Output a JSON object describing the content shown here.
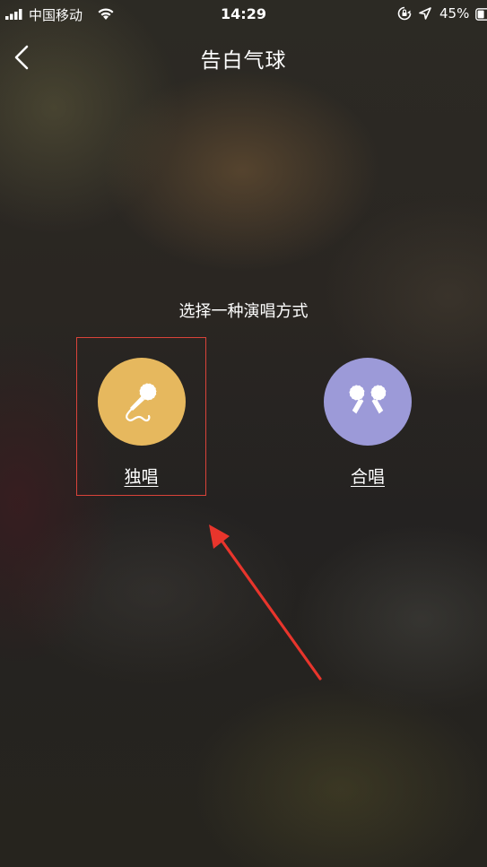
{
  "status_bar": {
    "carrier": "中国移动",
    "time": "14:29",
    "battery_percent": "45%",
    "icons": [
      "signal-icon",
      "wifi-icon",
      "rotation-lock-icon",
      "location-arrow-icon",
      "battery-icon"
    ]
  },
  "nav": {
    "back_icon": "chevron-left-icon",
    "title": "告白气球"
  },
  "main": {
    "prompt": "选择一种演唱方式",
    "options": [
      {
        "label": "独唱",
        "icon": "microphone-icon",
        "color": "#e6b85e"
      },
      {
        "label": "合唱",
        "icon": "two-microphones-icon",
        "color": "#9c9ad8"
      }
    ]
  },
  "annotation": {
    "highlight_color": "#d9433a",
    "arrow_color": "#e8352c"
  }
}
